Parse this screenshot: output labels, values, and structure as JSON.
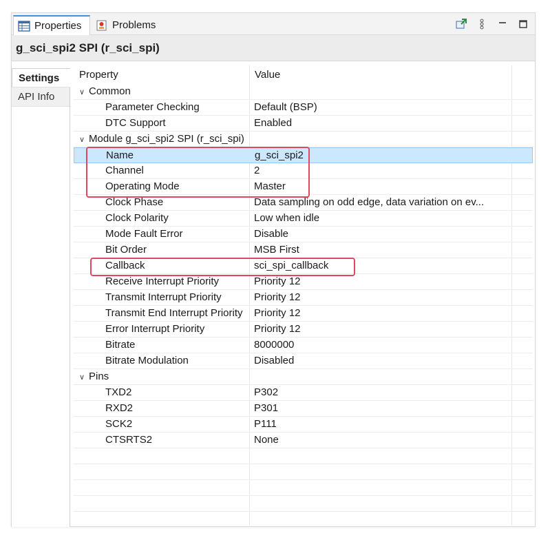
{
  "tabs": [
    {
      "label": "Properties",
      "icon": "properties-table-icon",
      "active": true
    },
    {
      "label": "Problems",
      "icon": "problems-icon",
      "active": false
    }
  ],
  "toolbar": {
    "icons": [
      "pin-icon",
      "view-menu-icon",
      "minimize-icon",
      "maximize-icon"
    ]
  },
  "header": {
    "title": "g_sci_spi2 SPI (r_sci_spi)"
  },
  "side_tabs": [
    {
      "label": "Settings",
      "active": true
    },
    {
      "label": "API Info",
      "active": false
    }
  ],
  "table": {
    "columns": [
      "Property",
      "Value"
    ],
    "rows": [
      {
        "kind": "cat",
        "prop": "Common",
        "val": ""
      },
      {
        "kind": "child",
        "prop": "Parameter Checking",
        "val": "Default (BSP)"
      },
      {
        "kind": "child",
        "prop": "DTC Support",
        "val": "Enabled"
      },
      {
        "kind": "cat",
        "prop": "Module g_sci_spi2 SPI (r_sci_spi)",
        "val": ""
      },
      {
        "kind": "child",
        "prop": "Name",
        "val": "g_sci_spi2",
        "selected": true
      },
      {
        "kind": "child",
        "prop": "Channel",
        "val": "2"
      },
      {
        "kind": "child",
        "prop": "Operating Mode",
        "val": "Master"
      },
      {
        "kind": "child",
        "prop": "Clock Phase",
        "val": "Data sampling on odd edge, data variation on ev..."
      },
      {
        "kind": "child",
        "prop": "Clock Polarity",
        "val": "Low when idle"
      },
      {
        "kind": "child",
        "prop": "Mode Fault Error",
        "val": "Disable"
      },
      {
        "kind": "child",
        "prop": "Bit Order",
        "val": "MSB First"
      },
      {
        "kind": "child",
        "prop": "Callback",
        "val": "sci_spi_callback"
      },
      {
        "kind": "child",
        "prop": "Receive Interrupt Priority",
        "val": "Priority 12"
      },
      {
        "kind": "child",
        "prop": "Transmit Interrupt Priority",
        "val": "Priority 12"
      },
      {
        "kind": "child",
        "prop": "Transmit End Interrupt Priority",
        "val": "Priority 12"
      },
      {
        "kind": "child",
        "prop": "Error Interrupt Priority",
        "val": "Priority 12"
      },
      {
        "kind": "child",
        "prop": "Bitrate",
        "val": "8000000"
      },
      {
        "kind": "child",
        "prop": "Bitrate Modulation",
        "val": "Disabled"
      },
      {
        "kind": "cat",
        "prop": "Pins",
        "val": ""
      },
      {
        "kind": "child",
        "prop": "TXD2",
        "val": "P302"
      },
      {
        "kind": "child",
        "prop": "RXD2",
        "val": "P301"
      },
      {
        "kind": "child",
        "prop": "SCK2",
        "val": "P111"
      },
      {
        "kind": "child",
        "prop": "CTSRTS2",
        "val": "None"
      }
    ],
    "empty_rows": 5
  },
  "colors": {
    "selection": "#cce8ff",
    "highlight_box": "#e0475f",
    "accent": "#4a90d9"
  }
}
